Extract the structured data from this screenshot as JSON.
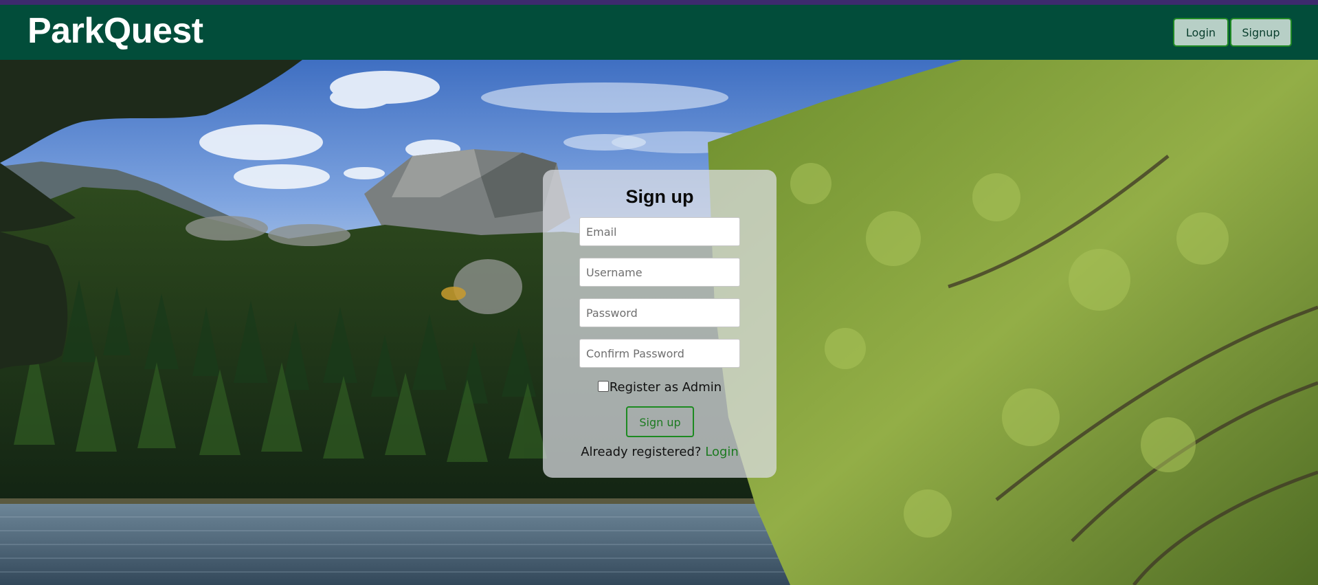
{
  "header": {
    "brand": "ParkQuest",
    "login_label": "Login",
    "signup_label": "Signup"
  },
  "form": {
    "title": "Sign up",
    "email_placeholder": "Email",
    "username_placeholder": "Username",
    "password_placeholder": "Password",
    "confirm_placeholder": "Confirm Password",
    "admin_label": "Register as Admin",
    "admin_checked": false,
    "submit_label": "Sign up",
    "already_text": "Already registered?",
    "login_link": "Login"
  },
  "background": {
    "description_icon": "mountain-lake-photo-image"
  },
  "colors": {
    "nav_bg": "#024d3a",
    "top_strip": "#3d2a6e",
    "accent_green": "#1c8a20"
  }
}
